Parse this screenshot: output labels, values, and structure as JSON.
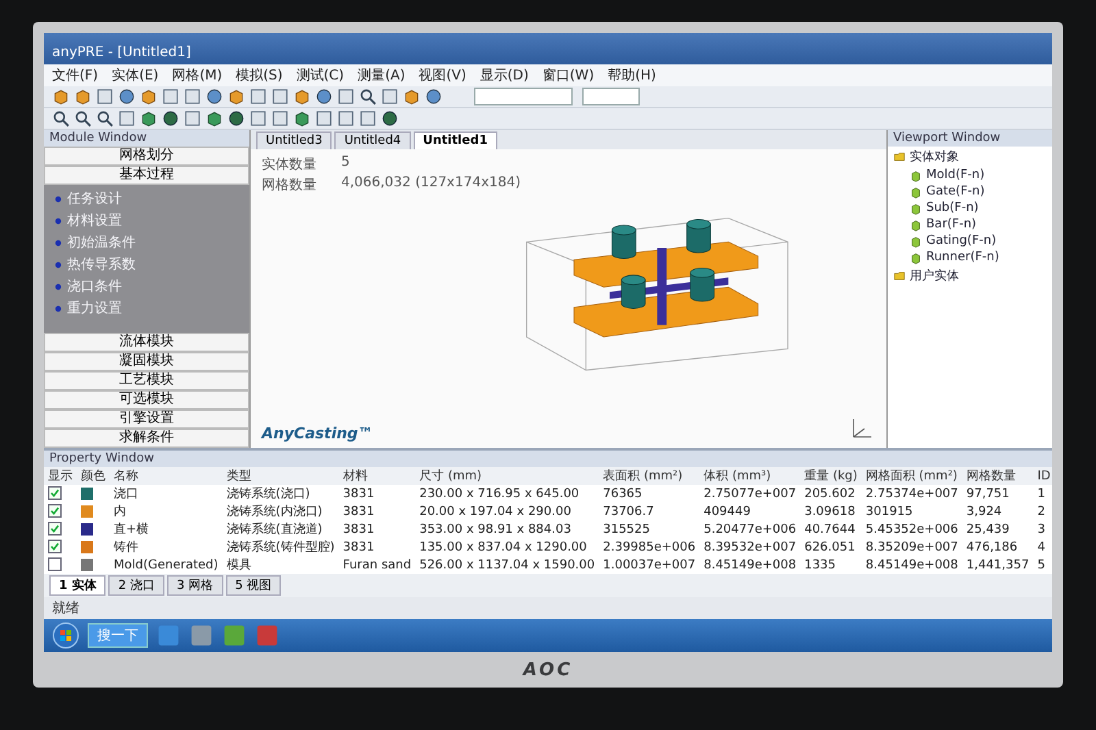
{
  "window": {
    "title": "anyPRE - [Untitled1]"
  },
  "menu": [
    "文件(F)",
    "实体(E)",
    "网格(M)",
    "模拟(S)",
    "测试(C)",
    "测量(A)",
    "视图(V)",
    "显示(D)",
    "窗口(W)",
    "帮助(H)"
  ],
  "doc_tabs": [
    {
      "label": "Untitled3",
      "selected": false
    },
    {
      "label": "Untitled4",
      "selected": false
    },
    {
      "label": "Untitled1",
      "selected": true
    }
  ],
  "module_window": {
    "title": "Module Window",
    "sections": [
      "网格划分",
      "基本过程"
    ],
    "items": [
      "任务设计",
      "材料设置",
      "初始温条件",
      "热传导系数",
      "浇口条件",
      "重力设置"
    ],
    "modules": [
      "流体模块",
      "凝固模块",
      "工艺模块",
      "可选模块",
      "引擎设置",
      "求解条件"
    ]
  },
  "viewport": {
    "info": [
      {
        "label": "实体数量",
        "value": "5"
      },
      {
        "label": "网格数量",
        "value": "4,066,032 (127x174x184)"
      }
    ],
    "logo": "AnyCasting™"
  },
  "viewport_window": {
    "title": "Viewport Window",
    "tree": [
      {
        "label": "实体对象",
        "children": [
          {
            "label": "Mold(F-n)"
          },
          {
            "label": "Gate(F-n)"
          },
          {
            "label": "Sub(F-n)"
          },
          {
            "label": "Bar(F-n)"
          },
          {
            "label": "Gating(F-n)"
          },
          {
            "label": "Runner(F-n)"
          }
        ]
      },
      {
        "label": "用户实体"
      }
    ]
  },
  "property_window": {
    "title": "Property Window",
    "marker_columns": [
      "显示",
      "颜色"
    ],
    "columns": [
      "名称",
      "类型",
      "材料",
      "尺寸 (mm)",
      "表面积 (mm²)",
      "体积 (mm³)",
      "重量 (kg)",
      "网格面积 (mm²)",
      "网格数量",
      "ID"
    ],
    "rows": [
      {
        "visible": true,
        "color": "#1f6f6a",
        "cells": [
          "浇口",
          "浇铸系统(浇口)",
          "3831",
          "230.00 x 716.95 x 645.00",
          "76365",
          "2.75077e+007",
          "205.602",
          "2.75374e+007",
          "97,751",
          "1"
        ]
      },
      {
        "visible": true,
        "color": "#e08a1e",
        "cells": [
          "内",
          "浇铸系统(内浇口)",
          "3831",
          "20.00 x 197.04 x 290.00",
          "73706.7",
          "409449",
          "3.09618",
          "301915",
          "3,924",
          "2"
        ]
      },
      {
        "visible": true,
        "color": "#2a2a8a",
        "cells": [
          "直+横",
          "浇铸系统(直浇道)",
          "3831",
          "353.00 x 98.91 x 884.03",
          "315525",
          "5.20477e+006",
          "40.7644",
          "5.45352e+006",
          "25,439",
          "3"
        ]
      },
      {
        "visible": true,
        "color": "#d9781a",
        "cells": [
          "铸件",
          "浇铸系统(铸件型腔)",
          "3831",
          "135.00 x 837.04 x 1290.00",
          "2.39985e+006",
          "8.39532e+007",
          "626.051",
          "8.35209e+007",
          "476,186",
          "4"
        ]
      },
      {
        "visible": false,
        "color": "#777777",
        "cells": [
          "Mold(Generated)",
          "模具",
          "Furan sand",
          "526.00 x 1137.04 x 1590.00",
          "1.00037e+007",
          "8.45149e+008",
          "1335",
          "8.45149e+008",
          "1,441,357",
          "5"
        ]
      }
    ],
    "tabs": [
      {
        "label": "1 实体",
        "selected": true
      },
      {
        "label": "2 浇口",
        "selected": false
      },
      {
        "label": "3 网格",
        "selected": false
      },
      {
        "label": "5 视图",
        "selected": false
      }
    ]
  },
  "status_bar": {
    "text": "就绪"
  },
  "taskbar": {
    "search": "搜一下"
  },
  "monitor": {
    "brand": "AOC"
  }
}
